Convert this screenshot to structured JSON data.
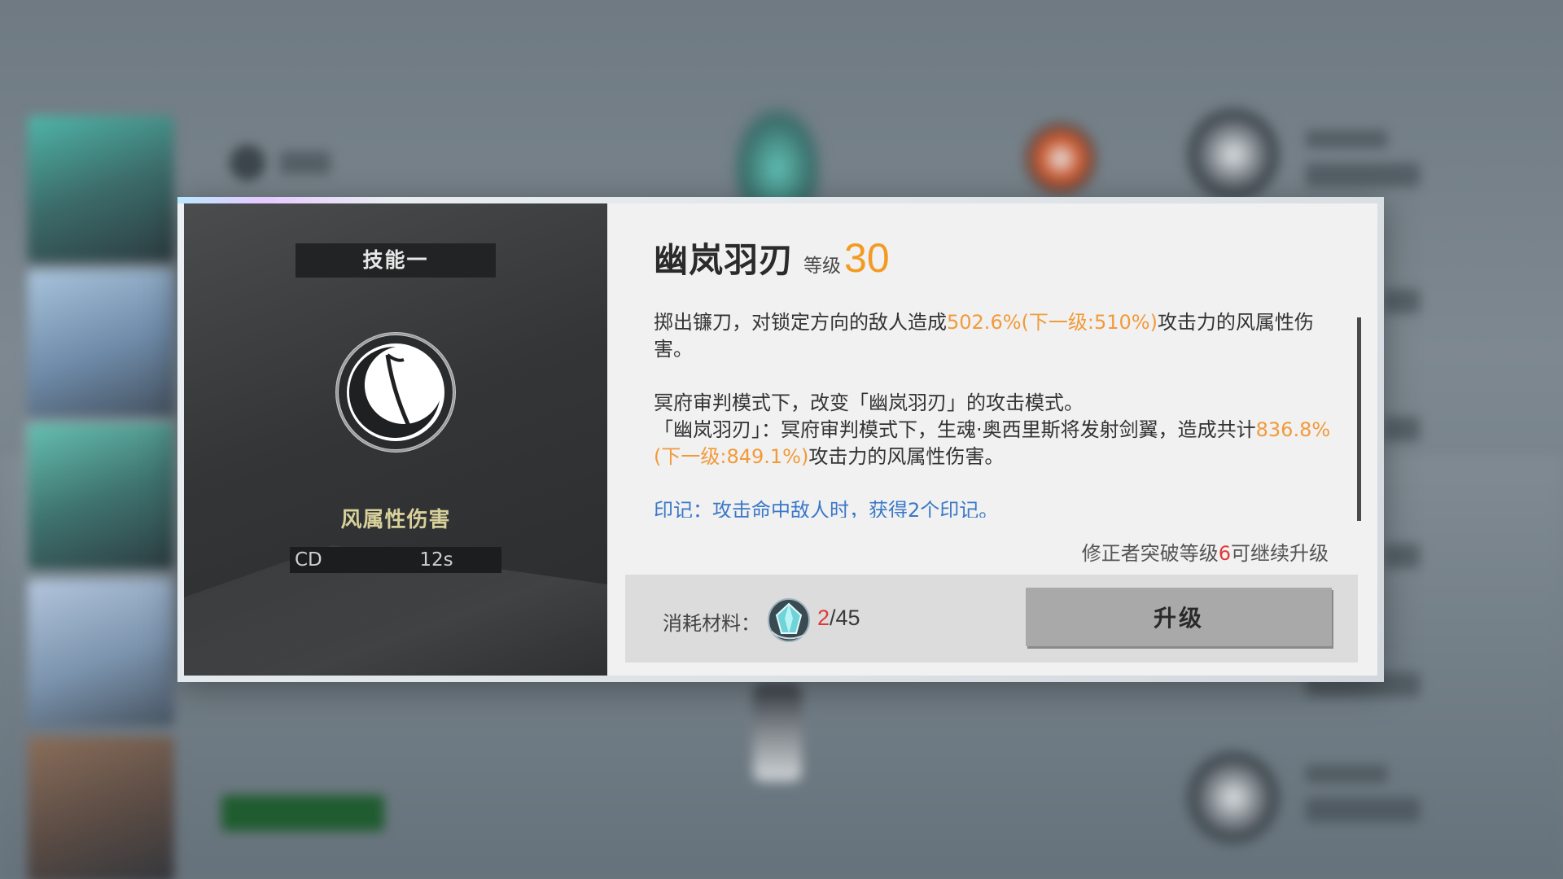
{
  "skill": {
    "slot_label": "技能一",
    "name": "幽岚羽刃",
    "level_label": "等级",
    "level": "30",
    "damage_type": "风属性伤害",
    "cd_label": "CD",
    "cd_value": "12s"
  },
  "description": {
    "para1_prefix": "掷出镰刀，对锁定方向的敌人造成",
    "para1_highlight": "502.6%(下一级:510%)",
    "para1_suffix": "攻击力的风属性伤害。",
    "para2_line1": "冥府审判模式下，改变「幽岚羽刃」的攻击模式。",
    "para2_line2_prefix": "「幽岚羽刃」：冥府审判模式下，生魂·奥西里斯将发射剑翼，造成共计",
    "para2_highlight": "836.8%(下一级:849.1%)",
    "para2_suffix": "攻击力的风属性伤害。",
    "note": "印记：攻击命中敌人时，获得2个印记。"
  },
  "upgrade_hint": {
    "prefix": "修正者突破等级",
    "required_level": "6",
    "suffix": "可继续升级"
  },
  "cost": {
    "label": "消耗材料：",
    "have": "2",
    "need": "/45"
  },
  "upgrade_button_label": "升级",
  "colors": {
    "level_accent": "#f39a22",
    "highlight": "#f29a3a",
    "note": "#3a78c8",
    "warning": "#e0393a",
    "damage_type": "#d8d09a"
  },
  "icons": {
    "skill": "scythe-crescent-icon",
    "material": "crystal-material-icon"
  }
}
